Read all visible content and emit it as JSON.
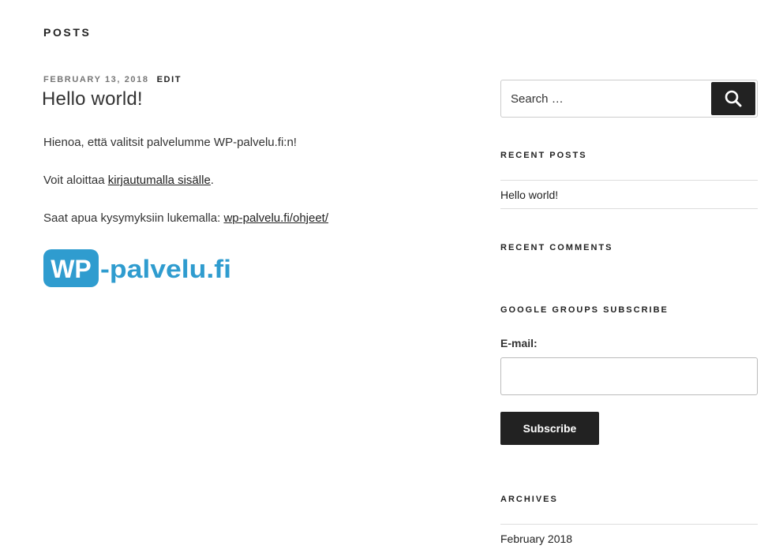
{
  "header": {
    "title": "POSTS"
  },
  "post": {
    "date": "FEBRUARY 13, 2018",
    "edit_label": "EDIT",
    "title": "Hello world!",
    "p1": "Hienoa, että valitsit palvelumme WP-palvelu.fi:n!",
    "p2_prefix": "Voit aloittaa ",
    "p2_link": "kirjautumalla sisälle",
    "p2_suffix": ".",
    "p3_prefix": "Saat apua kysymyksiin lukemalla: ",
    "p3_link": "wp-palvelu.fi/ohjeet/",
    "logo": {
      "text_wp": "WP",
      "text_rest": "-palvelu.fi",
      "color": "#2f9ccf"
    }
  },
  "sidebar": {
    "search": {
      "placeholder": "Search …",
      "button_label": "Search"
    },
    "recent_posts": {
      "title": "RECENT POSTS",
      "items": [
        "Hello world!"
      ]
    },
    "recent_comments": {
      "title": "RECENT COMMENTS"
    },
    "google_groups": {
      "title": "GOOGLE GROUPS SUBSCRIBE",
      "email_label": "E-mail:",
      "email_value": "",
      "subscribe_label": "Subscribe"
    },
    "archives": {
      "title": "ARCHIVES",
      "items": [
        "February 2018"
      ]
    }
  },
  "colors": {
    "text": "#333333",
    "heading": "#222222",
    "meta": "#767676",
    "logo_blue": "#2f9ccf"
  }
}
